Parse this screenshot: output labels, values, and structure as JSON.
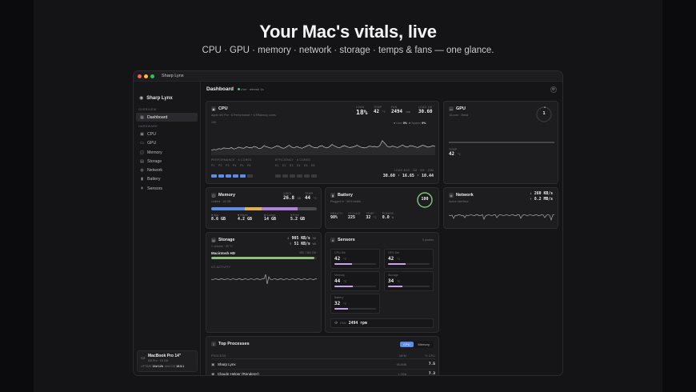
{
  "hero": {
    "title": "Your Mac's vitals, live",
    "subtitle": "CPU · GPU · memory · network · storage · temps & fans — one glance."
  },
  "window": {
    "title": "Sharp Lynx"
  },
  "sidebar": {
    "brand": "Sharp Lynx",
    "section_overview": "OVERVIEW",
    "dashboard": "Dashboard",
    "section_hardware": "HARDWARE",
    "items": [
      {
        "label": "CPU",
        "icon": "cpu-icon"
      },
      {
        "label": "GPU",
        "icon": "gpu-icon"
      },
      {
        "label": "Memory",
        "icon": "memory-icon"
      },
      {
        "label": "Storage",
        "icon": "storage-icon"
      },
      {
        "label": "Network",
        "icon": "network-icon"
      },
      {
        "label": "Battery",
        "icon": "battery-icon"
      },
      {
        "label": "Sensors",
        "icon": "thermometer-icon"
      }
    ],
    "machine": {
      "name": "MacBook Pro 14\"",
      "sub": "M3 Pro · 18 GB",
      "uptime_label": "UPTIME",
      "uptime": "16d 12h",
      "macos_label": "MACOS",
      "macos": "15.5.1"
    }
  },
  "dashboard": {
    "title": "Dashboard",
    "live": "Live · refresh 1s"
  },
  "cpu": {
    "title": "CPU",
    "subtitle": "Apple M3 Pro · 6 Performance + 6 Efficiency cores",
    "range": "100",
    "load_label": "LOAD",
    "load": "18%",
    "temp_label": "TEMP",
    "temp": "42",
    "temp_unit": "°C",
    "fan_label": "FAN",
    "fan": "2494",
    "fan_unit": "rpm",
    "loadavg_label": "LOAD 1M",
    "loadavg": "30.60",
    "legend_user": "User",
    "legend_user_val": "9%",
    "legend_system": "System",
    "legend_system_val": "9%",
    "perf_label": "PERFORMANCE · 6 CORES",
    "eff_label": "EFFICIENCY · 6 CORES",
    "perf_core_names": [
      "P1",
      "P2",
      "P3",
      "P4",
      "P5",
      "P6"
    ],
    "eff_core_names": [
      "E1",
      "E2",
      "E3",
      "E4",
      "E5",
      "E6"
    ],
    "loadavg_row_label": "LOAD AVG · 1M · 5M · 15M",
    "loadavg_row": "30.60 · 16.65 · 10.44",
    "history": [
      30,
      32,
      31,
      34,
      33,
      36,
      35,
      34,
      37,
      33,
      35,
      38,
      36,
      35,
      39,
      37,
      36,
      40,
      38,
      34,
      36,
      42,
      39,
      37,
      35,
      38,
      41,
      40,
      36,
      35,
      39,
      43,
      38,
      36,
      40,
      37,
      35,
      38,
      41,
      44,
      39,
      37,
      36,
      40,
      42,
      38,
      36,
      39,
      45,
      41,
      38,
      36,
      40,
      42,
      39,
      37,
      38,
      40,
      43,
      39,
      37,
      36,
      38,
      41,
      39,
      40,
      38,
      42,
      55,
      48,
      40,
      38,
      41,
      39,
      37,
      40,
      44,
      40,
      38,
      42,
      41,
      39,
      37,
      40,
      43,
      41,
      38,
      39,
      42,
      40
    ]
  },
  "gpu": {
    "title": "GPU",
    "subtitle": "18-core · Metal",
    "gauge": "1",
    "temp_label": "TEMP",
    "temp": "42",
    "temp_unit": "°C"
  },
  "memory": {
    "title": "Memory",
    "subtitle": "Unified · 18 GB",
    "used_label": "USED",
    "used": "26.8",
    "used_unit": "GB",
    "temp_label": "TEMP",
    "temp": "44",
    "temp_unit": "°C",
    "legend": [
      {
        "label": "App",
        "value": "8.6 GB",
        "color": "#5b8de8"
      },
      {
        "label": "Wired",
        "value": "4.2 GB",
        "color": "#e0b34a"
      },
      {
        "label": "Compr.",
        "value": "14 GB",
        "color": "#b07fe0"
      },
      {
        "label": "Free",
        "value": "5.2 GB",
        "color": "#48484e"
      }
    ],
    "segments": [
      0.32,
      0.16,
      0.34,
      0.18
    ]
  },
  "battery": {
    "title": "Battery",
    "subtitle": "Plugged in · 96% health",
    "percent": "100",
    "health_label": "HEALTH",
    "health": "98%",
    "cycles_label": "CYCLES",
    "cycles": "225",
    "temp_label": "TEMP",
    "temp": "32",
    "temp_unit": "°C",
    "power_label": "POWER",
    "power": "0.0",
    "power_unit": "W"
  },
  "network": {
    "title": "Network",
    "subtitle": "Active interface",
    "down": "260 KB/s",
    "up": "8.2 MB/s"
  },
  "storage": {
    "title": "Storage",
    "subtitle": "1 volume · 95 °C",
    "read": "905 KB/s",
    "read_label": "RD",
    "write": "51 KB/s",
    "write_label": "WR",
    "volume": "Macintosh HD",
    "volume_size": "450 / 460 GB",
    "volume_fill": 0.98,
    "activity_label": "I/O ACTIVITY"
  },
  "sensors": {
    "title": "Sensors",
    "count": "5 probes",
    "tiles": [
      {
        "label": "CPU Die",
        "value": "42",
        "unit": "°C",
        "fill": 0.42
      },
      {
        "label": "GPU Die",
        "value": "42",
        "unit": "°C",
        "fill": 0.42
      },
      {
        "label": "Memory",
        "value": "44",
        "unit": "°C",
        "fill": 0.44
      },
      {
        "label": "Storage",
        "value": "34",
        "unit": "°C",
        "fill": 0.34
      },
      {
        "label": "Battery",
        "value": "32",
        "unit": "°C",
        "fill": 0.32
      }
    ],
    "fan_label": "FAN",
    "fan": "2494 rpm"
  },
  "processes": {
    "title": "Top Processes",
    "tab_cpu": "CPU",
    "tab_memory": "Memory",
    "col_process": "PROCESS",
    "col_mem": "MEM",
    "col_cpu": "% CPU",
    "rows": [
      {
        "name": "Sharp Lynx",
        "mem": "96.8MB",
        "cpu": "7.5"
      },
      {
        "name": "Claude Helper (Renderer)",
        "mem": "1.3GB",
        "cpu": "7.3"
      }
    ]
  },
  "colors": {
    "accent": "#5b8de8",
    "green": "#7ec07b",
    "bg": "#151517",
    "card": "#1d1d20"
  }
}
